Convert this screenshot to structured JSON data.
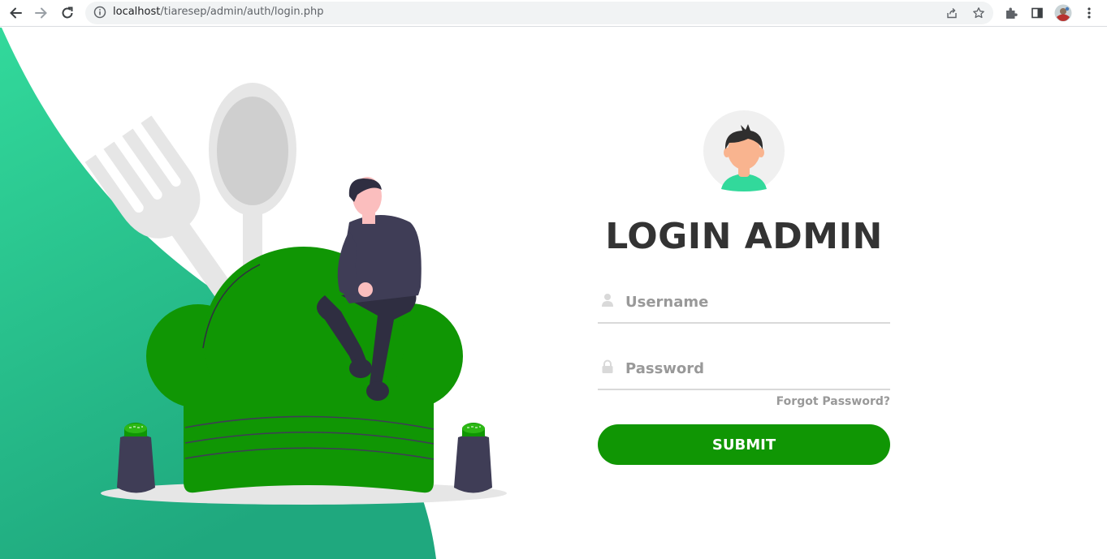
{
  "browser": {
    "url_host": "localhost",
    "url_path": "/tiaresep/admin/auth/login.php",
    "icons": [
      "back-arrow-icon",
      "forward-arrow-icon",
      "reload-icon",
      "site-info-icon",
      "share-icon",
      "bookmark-star-icon",
      "extensions-icon",
      "side-panel-icon",
      "profile-avatar",
      "menu-kebab-icon"
    ]
  },
  "login": {
    "title": "LOGIN ADMIN",
    "username_placeholder": "Username",
    "password_placeholder": "Password",
    "forgot_label": "Forgot Password?",
    "submit_label": "SUBMIT"
  },
  "colors": {
    "accent_green": "#109604",
    "teal_gradient_start": "#32d99b",
    "teal_gradient_end": "#1fa87e",
    "title_text": "#333333",
    "placeholder_text": "#999999"
  }
}
